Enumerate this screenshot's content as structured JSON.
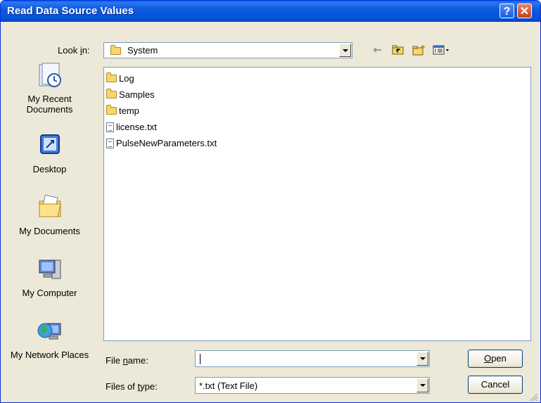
{
  "window": {
    "title": "Read Data Source Values",
    "help_icon": "help-icon",
    "close_icon": "close-icon"
  },
  "toolbar": {
    "look_in_label": "Look in:",
    "look_in_value": "System",
    "back_icon": "back-arrow-icon",
    "up_icon": "up-folder-icon",
    "new_folder_icon": "new-folder-icon",
    "views_icon": "views-menu-icon"
  },
  "places": [
    {
      "label": "My Recent Documents",
      "icon": "recent-documents-icon"
    },
    {
      "label": "Desktop",
      "icon": "desktop-icon"
    },
    {
      "label": "My Documents",
      "icon": "my-documents-icon"
    },
    {
      "label": "My Computer",
      "icon": "my-computer-icon"
    },
    {
      "label": "My Network Places",
      "icon": "network-places-icon"
    }
  ],
  "files": [
    {
      "name": "Log",
      "type": "folder"
    },
    {
      "name": "Samples",
      "type": "folder"
    },
    {
      "name": "temp",
      "type": "folder"
    },
    {
      "name": "license.txt",
      "type": "file"
    },
    {
      "name": "PulseNewParameters.txt",
      "type": "file"
    }
  ],
  "form": {
    "file_name_label": "File name:",
    "file_name_value": "",
    "files_of_type_label": "Files of type:",
    "files_of_type_value": "*.txt (Text File)"
  },
  "buttons": {
    "open": "Open",
    "cancel": "Cancel"
  },
  "colors": {
    "titlebar": "#0352d8",
    "dialog_bg": "#ece9d8",
    "border": "#7f9db9"
  }
}
